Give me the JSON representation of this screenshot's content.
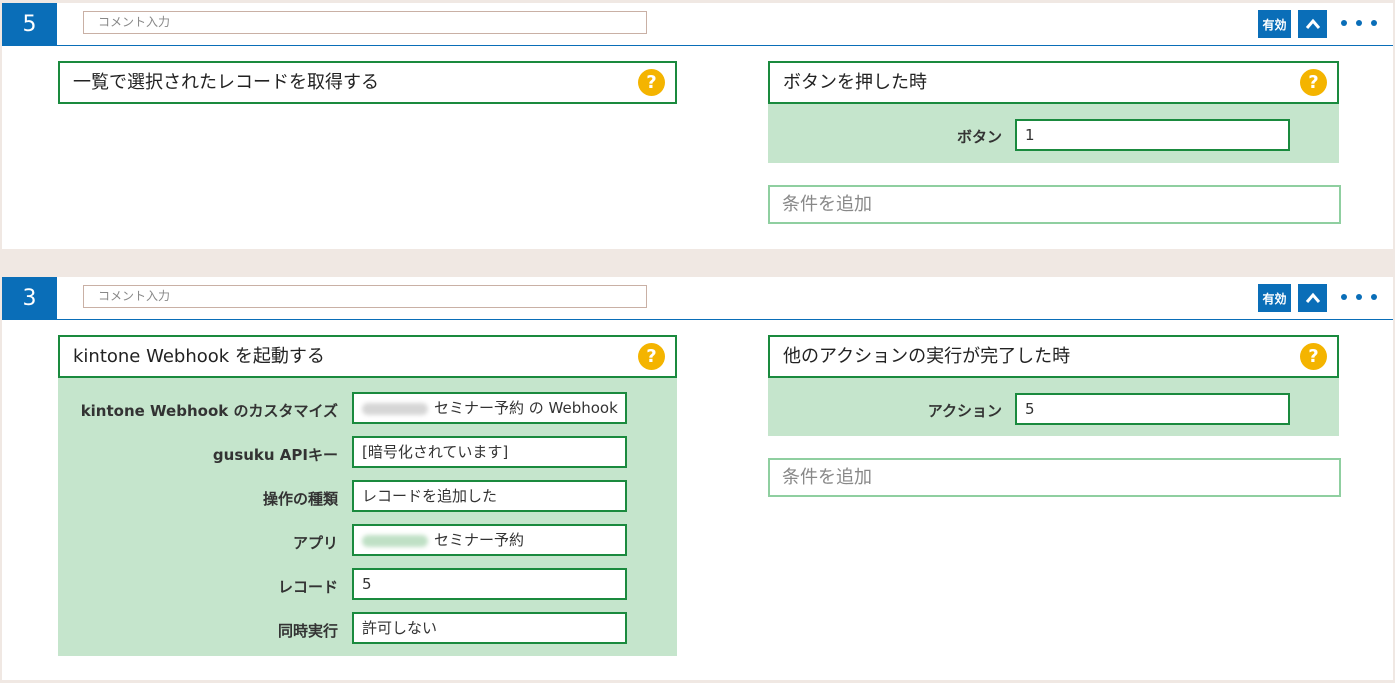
{
  "blocks": [
    {
      "number": "5",
      "comment_placeholder": "コメント入力",
      "enabled_label": "有効",
      "action": {
        "title": "一覧で選択されたレコードを取得する"
      },
      "trigger": {
        "title": "ボタンを押した時",
        "fields": [
          {
            "label": "ボタン",
            "value": "1"
          }
        ],
        "add_condition": "条件を追加"
      }
    },
    {
      "number": "3",
      "comment_placeholder": "コメント入力",
      "enabled_label": "有効",
      "action": {
        "title": "kintone Webhook を起動する",
        "fields": [
          {
            "label": "kintone Webhook のカスタマイズ",
            "value": "セミナー予約 の Webhook"
          },
          {
            "label": "gusuku APIキー",
            "value": "[暗号化されています]"
          },
          {
            "label": "操作の種類",
            "value": "レコードを追加した"
          },
          {
            "label": "アプリ",
            "value": "セミナー予約"
          },
          {
            "label": "レコード",
            "value": "5"
          },
          {
            "label": "同時実行",
            "value": "許可しない"
          }
        ]
      },
      "trigger": {
        "title": "他のアクションの実行が完了した時",
        "fields": [
          {
            "label": "アクション",
            "value": "5"
          }
        ],
        "add_condition": "条件を追加"
      }
    }
  ],
  "icons": {
    "help": "help-icon",
    "collapse": "chevron-up-icon",
    "more": "more-dots-icon"
  },
  "colors": {
    "primary": "#0a6eb8",
    "panel": "#c5e5cc",
    "border": "#1a8a3e",
    "help": "#f4b400"
  }
}
